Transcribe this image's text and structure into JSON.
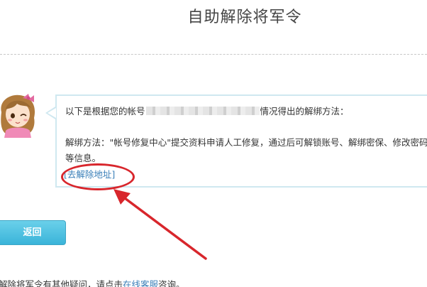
{
  "page": {
    "title": "自助解除将军令"
  },
  "message": {
    "line1_prefix": "以下是根据您的帐号",
    "line1_suffix": "情况得出的解绑方法：",
    "method_text": "解绑方法：\"帐号修复中心\"提交资料申请人工修复，通过后可解锁账号、解绑密保、修改密码等信息。",
    "remove_link": "[去解除地址]"
  },
  "actions": {
    "back_label": "返回"
  },
  "footer": {
    "prefix": "解除将军令有其他疑问，请点击",
    "link": "在线客服",
    "suffix": "咨询。"
  },
  "annotation": {
    "highlight_color": "#d8262c"
  }
}
